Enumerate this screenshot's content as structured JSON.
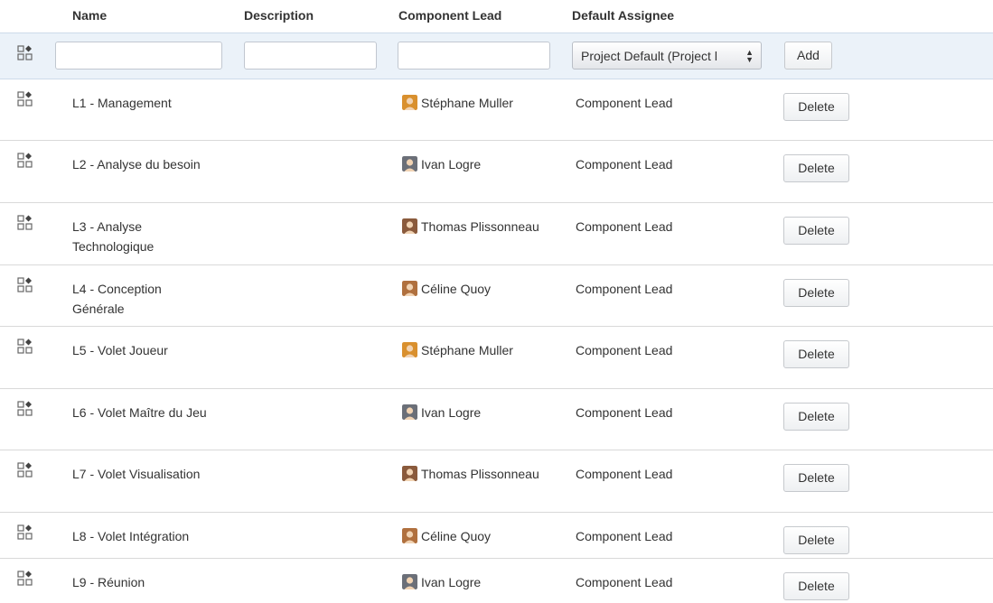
{
  "headers": {
    "name": "Name",
    "description": "Description",
    "lead": "Component Lead",
    "assignee": "Default Assignee"
  },
  "add_row": {
    "name_value": "",
    "description_value": "",
    "lead_value": "",
    "assignee_selected": "Project Default (Project l",
    "add_label": "Add"
  },
  "rows": [
    {
      "name": "L1 - Management",
      "lead": "Stéphane Muller",
      "lead_avatar": "user-avatar-stephane",
      "assignee": "Component Lead",
      "delete_label": "Delete"
    },
    {
      "name": "L2 - Analyse du besoin",
      "lead": "Ivan Logre",
      "lead_avatar": "user-avatar-ivan",
      "assignee": "Component Lead",
      "delete_label": "Delete"
    },
    {
      "name": "L3 - Analyse Technologique",
      "lead": "Thomas Plissonneau",
      "lead_avatar": "user-avatar-thomas",
      "assignee": "Component Lead",
      "delete_label": "Delete"
    },
    {
      "name": "L4 - Conception Générale",
      "lead": "Céline Quoy",
      "lead_avatar": "user-avatar-celine",
      "assignee": "Component Lead",
      "delete_label": "Delete"
    },
    {
      "name": "L5 - Volet Joueur",
      "lead": "Stéphane Muller",
      "lead_avatar": "user-avatar-stephane",
      "assignee": "Component Lead",
      "delete_label": "Delete"
    },
    {
      "name": "L6 - Volet Maître du Jeu",
      "lead": "Ivan Logre",
      "lead_avatar": "user-avatar-ivan",
      "assignee": "Component Lead",
      "delete_label": "Delete"
    },
    {
      "name": "L7 - Volet Visualisation",
      "lead": "Thomas Plissonneau",
      "lead_avatar": "user-avatar-thomas",
      "assignee": "Component Lead",
      "delete_label": "Delete"
    },
    {
      "name": "L8 - Volet Intégration",
      "lead": "Céline Quoy",
      "lead_avatar": "user-avatar-celine",
      "assignee": "Component Lead",
      "delete_label": "Delete"
    },
    {
      "name": "L9 - Réunion",
      "lead": "Ivan Logre",
      "lead_avatar": "user-avatar-ivan",
      "assignee": "Component Lead",
      "delete_label": "Delete"
    }
  ],
  "colors": {
    "add_row_bg": "#ebf2f9",
    "row_divider": "#d9d9d9",
    "text": "#333333"
  }
}
